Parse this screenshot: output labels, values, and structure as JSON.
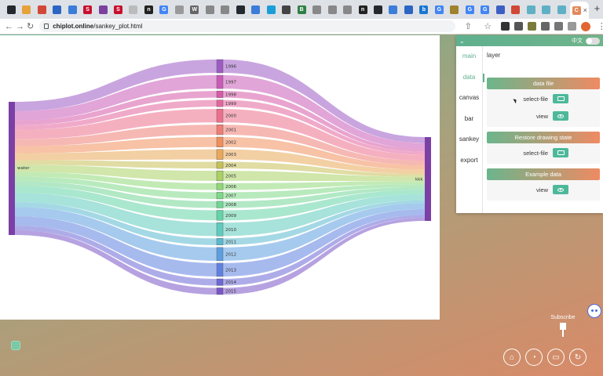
{
  "browser": {
    "tabs": [
      {
        "icon": "github-icon",
        "color": "#24292f",
        "glyph": ""
      },
      {
        "icon": "tab-icon",
        "color": "#e8a23c",
        "glyph": ""
      },
      {
        "icon": "mail-icon",
        "color": "#d14836",
        "glyph": ""
      },
      {
        "icon": "tab-icon",
        "color": "#2b66c4",
        "glyph": ""
      },
      {
        "icon": "tab-icon",
        "color": "#3b7dd8",
        "glyph": ""
      },
      {
        "icon": "springer-icon",
        "color": "#c8102e",
        "glyph": "S"
      },
      {
        "icon": "tab-icon",
        "color": "#7b3f9e",
        "glyph": ""
      },
      {
        "icon": "springer-icon",
        "color": "#c8102e",
        "glyph": "S"
      },
      {
        "icon": "tab-icon",
        "color": "#bbbbbb",
        "glyph": ""
      },
      {
        "icon": "tab-icon",
        "color": "#222222",
        "glyph": "n"
      },
      {
        "icon": "google-icon",
        "color": "#4285f4",
        "glyph": "G"
      },
      {
        "icon": "tab-icon",
        "color": "#999999",
        "glyph": ""
      },
      {
        "icon": "wikipedia-icon",
        "color": "#666666",
        "glyph": "W"
      },
      {
        "icon": "tab-icon",
        "color": "#888888",
        "glyph": ""
      },
      {
        "icon": "tab-icon",
        "color": "#888888",
        "glyph": ""
      },
      {
        "icon": "github-icon",
        "color": "#24292f",
        "glyph": ""
      },
      {
        "icon": "tab-icon",
        "color": "#3b7dd8",
        "glyph": ""
      },
      {
        "icon": "tab-icon",
        "color": "#1a9ed8",
        "glyph": ""
      },
      {
        "icon": "tab-icon",
        "color": "#444444",
        "glyph": ""
      },
      {
        "icon": "tab-icon",
        "color": "#2f7f45",
        "glyph": "B"
      },
      {
        "icon": "tab-icon",
        "color": "#888888",
        "glyph": ""
      },
      {
        "icon": "tab-icon",
        "color": "#888888",
        "glyph": ""
      },
      {
        "icon": "tab-icon",
        "color": "#888888",
        "glyph": ""
      },
      {
        "icon": "tab-icon",
        "color": "#222222",
        "glyph": "n"
      },
      {
        "icon": "github-icon",
        "color": "#24292f",
        "glyph": ""
      },
      {
        "icon": "tab-icon",
        "color": "#3b7dd8",
        "glyph": ""
      },
      {
        "icon": "tab-icon",
        "color": "#2b66c4",
        "glyph": ""
      },
      {
        "icon": "tab-icon",
        "color": "#1976d2",
        "glyph": "b"
      },
      {
        "icon": "google-icon",
        "color": "#4285f4",
        "glyph": "G"
      },
      {
        "icon": "tab-icon",
        "color": "#a0822c",
        "glyph": ""
      },
      {
        "icon": "google-icon",
        "color": "#4285f4",
        "glyph": "G"
      },
      {
        "icon": "google-icon",
        "color": "#4285f4",
        "glyph": "G"
      },
      {
        "icon": "tab-icon",
        "color": "#3b5fc4",
        "glyph": ""
      },
      {
        "icon": "tab-icon",
        "color": "#d14836",
        "glyph": ""
      },
      {
        "icon": "tab-icon",
        "color": "#5fb0c4",
        "glyph": ""
      },
      {
        "icon": "tab-icon",
        "color": "#5fb0c4",
        "glyph": ""
      },
      {
        "icon": "tab-icon",
        "color": "#5fb0c4",
        "glyph": ""
      },
      {
        "icon": "tab-icon",
        "color": "#e28a5c",
        "glyph": "C"
      }
    ],
    "new_tab": "+",
    "url_domain": "chiplot.online",
    "url_path": "/sankey_plot.html"
  },
  "panel": {
    "lang_label": "中文",
    "menu": [
      "main",
      "data",
      "canvas",
      "bar",
      "sankey",
      "export"
    ],
    "layer_label": "layer",
    "cards": [
      {
        "title": "data file",
        "rows": [
          {
            "label": "select-file",
            "icon": "folder-icon"
          },
          {
            "label": "view",
            "icon": "eye-icon"
          }
        ]
      },
      {
        "title": "Restore drawing state",
        "rows": [
          {
            "label": "select-file",
            "icon": "folder-icon"
          }
        ]
      },
      {
        "title": "Example data",
        "rows": [
          {
            "label": "view",
            "icon": "eye-icon"
          }
        ]
      }
    ],
    "accent": "#5fb08e",
    "gradient_end": "#ef8a63"
  },
  "widgets": {
    "subscribe_label": "Subscribe",
    "footer_icons": [
      "home-icon",
      "wechat-icon",
      "tv-icon",
      "refresh-icon"
    ]
  },
  "chart_data": {
    "type": "sankey",
    "source": "water",
    "target": "kkk",
    "nodes": [
      "1996",
      "1997",
      "1998",
      "1999",
      "2000",
      "2001",
      "2002",
      "2003",
      "2004",
      "2005",
      "2006",
      "2007",
      "2008",
      "2009",
      "2010",
      "2011",
      "2012",
      "2013",
      "2014",
      "2015"
    ],
    "values": [
      4,
      4,
      2,
      2,
      4,
      3,
      3,
      3,
      2,
      3,
      2,
      2,
      2,
      3,
      4,
      2,
      4,
      4,
      2,
      2
    ],
    "colors": [
      "#9d5bc4",
      "#c95bb8",
      "#d65aa8",
      "#e3659c",
      "#ec6f8c",
      "#ee7d75",
      "#f08f5d",
      "#e9a85a",
      "#c7c057",
      "#a9d264",
      "#90d878",
      "#7ed887",
      "#72d695",
      "#65d3a8",
      "#5ecbbd",
      "#5ab8d0",
      "#5c9ee0",
      "#5f82e0",
      "#6c68d6",
      "#7a55c6"
    ]
  }
}
